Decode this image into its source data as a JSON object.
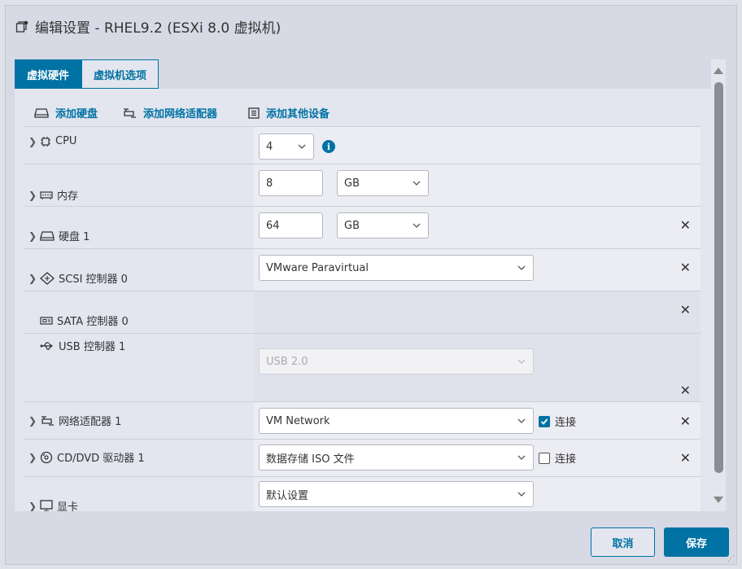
{
  "dialog": {
    "title": "编辑设置 - RHEL9.2 (ESXi 8.0 虚拟机)"
  },
  "tabs": [
    {
      "label": "虚拟硬件",
      "active": true
    },
    {
      "label": "虚拟机选项",
      "active": false
    }
  ],
  "actions": {
    "add_disk": "添加硬盘",
    "add_network": "添加网络适配器",
    "add_other": "添加其他设备"
  },
  "hardware": {
    "cpu": {
      "label": "CPU",
      "value": "4"
    },
    "memory": {
      "label": "内存",
      "value": "8",
      "unit": "GB"
    },
    "disk": {
      "label": "硬盘 1",
      "value": "64",
      "unit": "GB"
    },
    "scsi": {
      "label": "SCSI 控制器 0",
      "value": "VMware Paravirtual"
    },
    "sata": {
      "label": "SATA 控制器 0"
    },
    "usb": {
      "label": "USB 控制器 1",
      "value": "USB 2.0"
    },
    "network": {
      "label": "网络适配器 1",
      "value": "VM Network",
      "connect_label": "连接",
      "connected": true
    },
    "cddvd": {
      "label": "CD/DVD 驱动器 1",
      "value": "数据存储 ISO 文件",
      "connect_label": "连接",
      "connected": false
    },
    "video": {
      "label": "显卡",
      "value": "默认设置"
    }
  },
  "footer": {
    "cancel_label": "取消",
    "save_label": "保存"
  },
  "colors": {
    "accent": "#0072a3",
    "background": "#d7d9e4"
  }
}
